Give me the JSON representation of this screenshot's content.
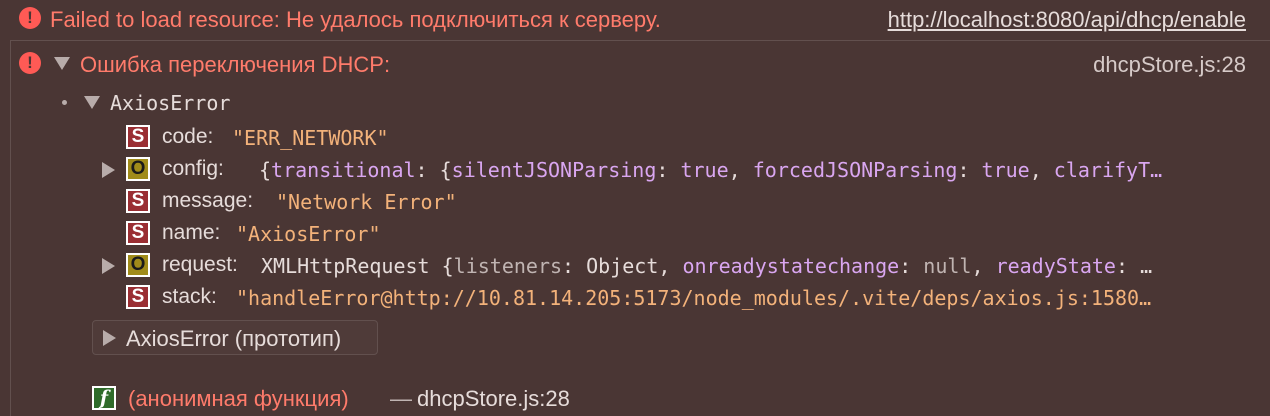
{
  "error1": {
    "message": "Failed to load resource: Не удалось подключиться к серверу.",
    "url": "http://localhost:8080/api/dhcp/enable"
  },
  "error2": {
    "message": "Ошибка переключения DHCP:",
    "source": "dhcpStore.js:28"
  },
  "object": {
    "name": "AxiosError",
    "props": {
      "code": {
        "badge": "S",
        "key": "code:",
        "value": "\"ERR_NETWORK\""
      },
      "config": {
        "badge": "O",
        "key": "config:",
        "parts": [
          "{",
          "transitional",
          ": {",
          "silentJSONParsing",
          ":",
          "true",
          ",",
          "forcedJSONParsing",
          ":",
          "true",
          ",",
          "clarifyT…"
        ]
      },
      "message": {
        "badge": "S",
        "key": "message:",
        "value": "\"Network Error\""
      },
      "name": {
        "badge": "S",
        "key": "name:",
        "value": "\"AxiosError\""
      },
      "request": {
        "badge": "O",
        "key": "request:",
        "parts": [
          "XMLHttpRequest {",
          "listeners",
          ": Object,",
          "onreadystatechange",
          ":",
          "null",
          ",",
          "readyState",
          ": …"
        ]
      },
      "stack": {
        "badge": "S",
        "key": "stack:",
        "value": "\"handleError@http://10.81.14.205:5173/node_modules/.vite/deps/axios.js:1580…"
      }
    },
    "prototype": "AxiosError (прототип)"
  },
  "frame": {
    "badge": "f",
    "name": "(анонимная функция)",
    "dash": "—",
    "source": "dhcpStore.js:28"
  }
}
